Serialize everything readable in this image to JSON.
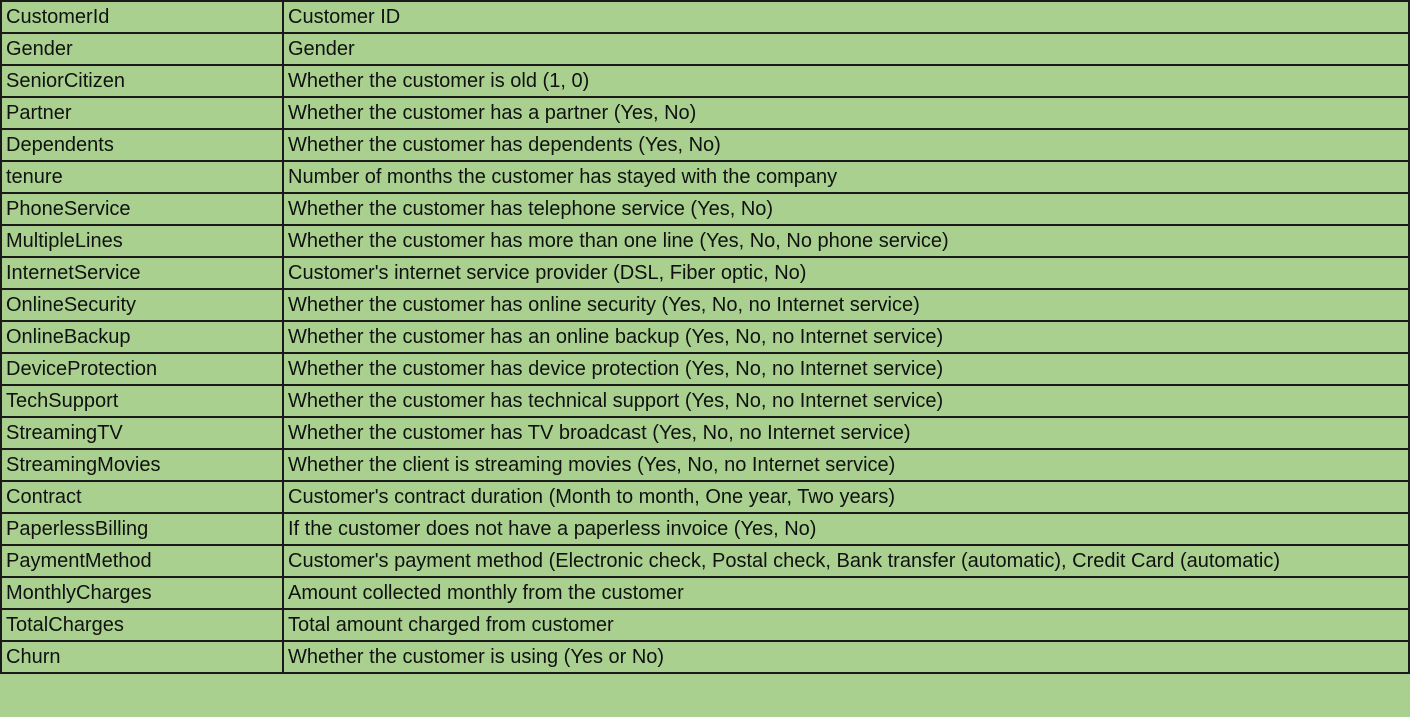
{
  "colors": {
    "cell_fill": "#a9d08e",
    "grid_line": "#1a1a1a",
    "text": "#111111"
  },
  "rows": [
    {
      "name": "CustomerId",
      "description": "Customer ID"
    },
    {
      "name": "Gender",
      "description": "Gender"
    },
    {
      "name": "SeniorCitizen",
      "description": "Whether the customer is old (1, 0)"
    },
    {
      "name": "Partner",
      "description": "Whether the customer has a partner (Yes, No)"
    },
    {
      "name": "Dependents",
      "description": "Whether the customer has dependents (Yes, No)"
    },
    {
      "name": "tenure",
      "description": "Number of months the customer has stayed with the company"
    },
    {
      "name": "PhoneService",
      "description": "Whether the customer has telephone service (Yes, No)"
    },
    {
      "name": "MultipleLines",
      "description": "Whether the customer has more than one line (Yes, No, No phone service)"
    },
    {
      "name": "InternetService",
      "description": "Customer's internet service provider (DSL, Fiber optic, No)"
    },
    {
      "name": "OnlineSecurity",
      "description": "Whether the customer has online security (Yes, No, no Internet service)"
    },
    {
      "name": "OnlineBackup",
      "description": "Whether the customer has an online backup (Yes, No, no Internet service)"
    },
    {
      "name": "DeviceProtection",
      "description": "Whether the customer has device protection (Yes, No, no Internet service)"
    },
    {
      "name": "TechSupport",
      "description": "Whether the customer has technical support (Yes, No, no Internet service)"
    },
    {
      "name": "StreamingTV",
      "description": "Whether the customer has TV broadcast (Yes, No, no Internet service)"
    },
    {
      "name": "StreamingMovies",
      "description": "Whether the client is streaming movies (Yes, No, no Internet service)"
    },
    {
      "name": "Contract",
      "description": "Customer's contract duration (Month to month, One year, Two years)"
    },
    {
      "name": "PaperlessBilling",
      "description": "If the customer does not have a paperless invoice (Yes, No)"
    },
    {
      "name": "PaymentMethod",
      "description": "Customer's payment method (Electronic check, Postal check, Bank transfer (automatic), Credit Card (automatic)"
    },
    {
      "name": "MonthlyCharges",
      "description": "Amount collected monthly from the customer"
    },
    {
      "name": "TotalCharges",
      "description": "Total amount charged from customer"
    },
    {
      "name": "Churn",
      "description": "Whether the customer is using (Yes or No)"
    }
  ]
}
